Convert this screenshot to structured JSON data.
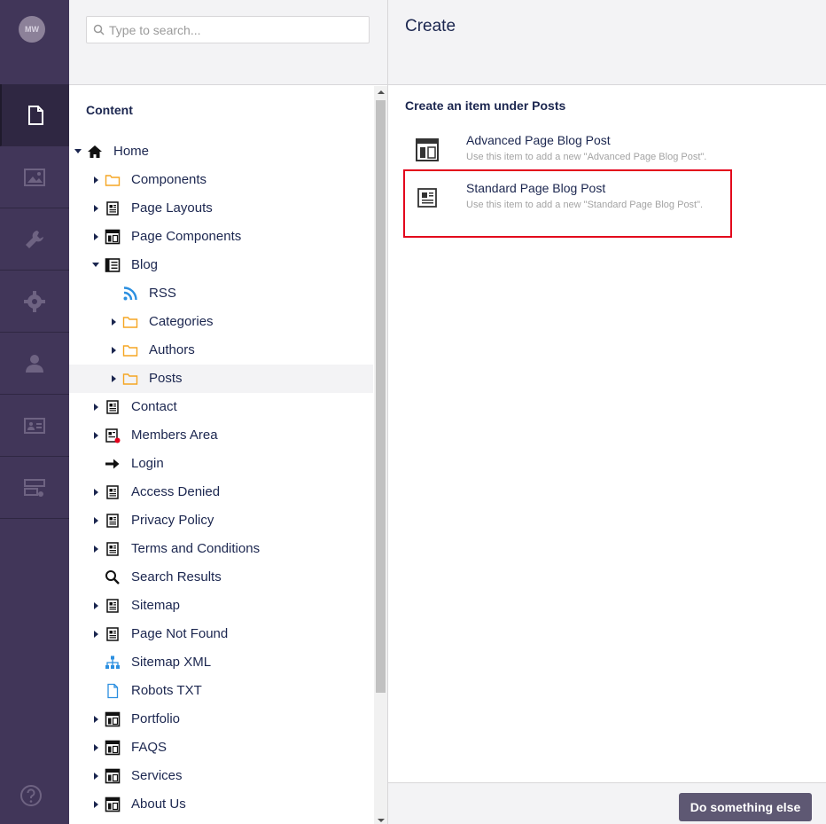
{
  "rail": {
    "avatar_initials": "MW",
    "sections": [
      {
        "name": "content",
        "icon": "document-icon",
        "active": true
      },
      {
        "name": "media",
        "icon": "image-icon",
        "active": false
      },
      {
        "name": "settings",
        "icon": "wrench-icon",
        "active": false
      },
      {
        "name": "packages",
        "icon": "gear-icon",
        "active": false
      },
      {
        "name": "users",
        "icon": "user-icon",
        "active": false
      },
      {
        "name": "members",
        "icon": "id-card-icon",
        "active": false
      },
      {
        "name": "forms",
        "icon": "form-icon",
        "active": false
      }
    ],
    "help_icon": "help-icon"
  },
  "search": {
    "placeholder": "Type to search..."
  },
  "tree": {
    "title": "Content",
    "nodes": [
      {
        "label": "Home",
        "depth": 0,
        "caret": "down",
        "icon": "home-icon"
      },
      {
        "label": "Components",
        "depth": 1,
        "caret": "right",
        "icon": "folder-icon"
      },
      {
        "label": "Page Layouts",
        "depth": 1,
        "caret": "right",
        "icon": "page-icon"
      },
      {
        "label": "Page Components",
        "depth": 1,
        "caret": "right",
        "icon": "layout-icon"
      },
      {
        "label": "Blog",
        "depth": 1,
        "caret": "down",
        "icon": "blog-icon"
      },
      {
        "label": "RSS",
        "depth": 2,
        "caret": "none",
        "icon": "rss-icon"
      },
      {
        "label": "Categories",
        "depth": 2,
        "caret": "right",
        "icon": "folder-icon"
      },
      {
        "label": "Authors",
        "depth": 2,
        "caret": "right",
        "icon": "folder-icon"
      },
      {
        "label": "Posts",
        "depth": 2,
        "caret": "right",
        "icon": "folder-icon",
        "selected": true
      },
      {
        "label": "Contact",
        "depth": 1,
        "caret": "right",
        "icon": "page-icon"
      },
      {
        "label": "Members Area",
        "depth": 1,
        "caret": "right",
        "icon": "page-locked-icon"
      },
      {
        "label": "Login",
        "depth": 1,
        "caret": "none",
        "icon": "arrow-right-icon"
      },
      {
        "label": "Access Denied",
        "depth": 1,
        "caret": "right",
        "icon": "page-icon"
      },
      {
        "label": "Privacy Policy",
        "depth": 1,
        "caret": "right",
        "icon": "page-icon"
      },
      {
        "label": "Terms and Conditions",
        "depth": 1,
        "caret": "right",
        "icon": "page-icon"
      },
      {
        "label": "Search Results",
        "depth": 1,
        "caret": "none",
        "icon": "search-icon"
      },
      {
        "label": "Sitemap",
        "depth": 1,
        "caret": "right",
        "icon": "page-icon"
      },
      {
        "label": "Page Not Found",
        "depth": 1,
        "caret": "right",
        "icon": "page-icon"
      },
      {
        "label": "Sitemap XML",
        "depth": 1,
        "caret": "none",
        "icon": "sitemap-icon"
      },
      {
        "label": "Robots TXT",
        "depth": 1,
        "caret": "none",
        "icon": "file-icon"
      },
      {
        "label": "Portfolio",
        "depth": 1,
        "caret": "right",
        "icon": "layout-icon"
      },
      {
        "label": "FAQS",
        "depth": 1,
        "caret": "right",
        "icon": "layout-icon"
      },
      {
        "label": "Services",
        "depth": 1,
        "caret": "right",
        "icon": "layout-icon"
      },
      {
        "label": "About Us",
        "depth": 1,
        "caret": "right",
        "icon": "layout-icon"
      }
    ]
  },
  "create": {
    "title": "Create",
    "subtitle": "Create an item under Posts",
    "items": [
      {
        "name": "Advanced Page Blog Post",
        "description": "Use this item to add a new \"Advanced Page Blog Post\".",
        "icon": "layout-icon"
      },
      {
        "name": "Standard Page Blog Post",
        "description": "Use this item to add a new \"Standard Page Blog Post\".",
        "icon": "page-icon",
        "highlighted": true
      }
    ],
    "button_label": "Do something else"
  },
  "colors": {
    "rail_bg": "#413659",
    "text": "#1b264f",
    "highlight_border": "#e3001b",
    "button_bg": "#5e5873",
    "folder": "#f5a623",
    "rss": "#2b8fe0"
  }
}
